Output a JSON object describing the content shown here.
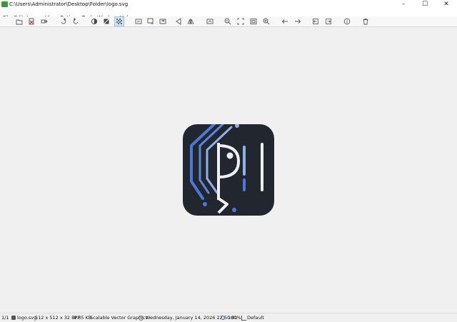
{
  "window": {
    "title": "C:\\Users\\Administrator\\Desktop\\Folder\\logo.svg",
    "minimize_glyph": "–",
    "maximize_glyph": "☐",
    "close_glyph": "✕"
  },
  "menu": [
    "File",
    "Edit",
    "Image",
    "View",
    "Options",
    "Tools",
    "Window",
    "Help"
  ],
  "toolbar": {
    "icons": [
      "open-icon",
      "delete-red-icon",
      "export-icon",
      "rotate-right-icon",
      "rotate-left-icon",
      "color-adjust-icon",
      "crop-icon",
      "transparency-grid-icon",
      "frame-icon",
      "resize-icon",
      "flip-icon",
      "previous-frame-icon",
      "mirror-icon",
      "compare-icon",
      "zoom-out-icon",
      "fit-icon",
      "actual-size-icon",
      "zoom-in-icon",
      "back-icon",
      "forward-icon",
      "first-icon",
      "last-icon",
      "info-icon",
      "trash-icon"
    ],
    "active": "transparency-grid-icon"
  },
  "status": {
    "index": "1/1",
    "filename": "logo.svg",
    "dimensions": "512 x 512 x 32 BPP",
    "size": "8.35 KB",
    "format": "Scalable Vector Graphics",
    "datetime": "Wednesday, January 14, 2026 22:50:01",
    "zoom": "100%",
    "color_profile": "Default"
  },
  "colors": {
    "logo_bg": "#22262e",
    "logo_blue": "#4a78d8",
    "logo_light_blue": "#8fb0e8",
    "logo_white": "#eef0f3"
  }
}
